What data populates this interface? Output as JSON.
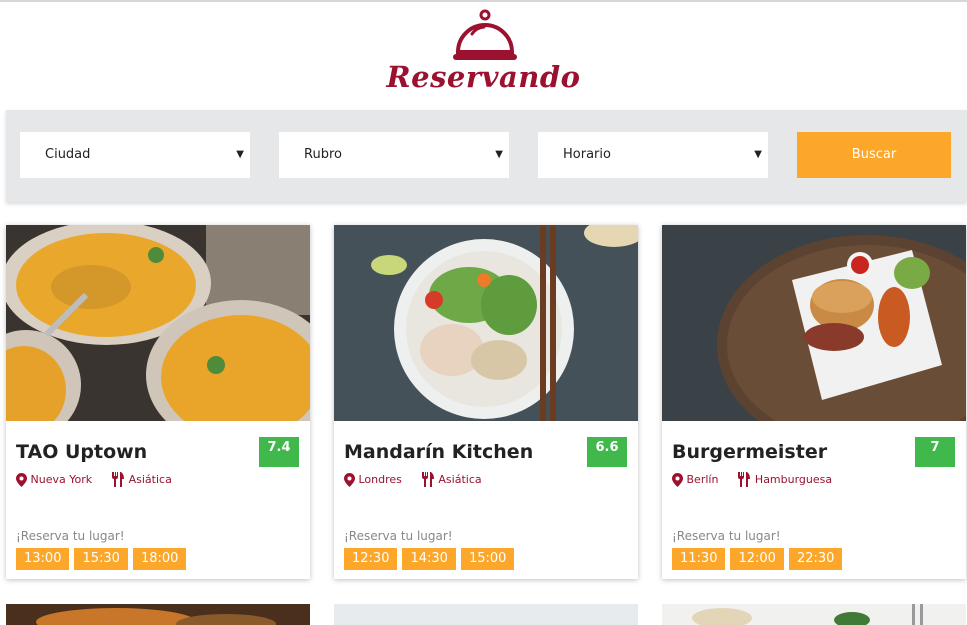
{
  "brand": {
    "name": "Reservando",
    "color": "#9b1230"
  },
  "search": {
    "city_label": "Ciudad",
    "rubro_label": "Rubro",
    "hour_label": "Horario",
    "button_label": "Buscar",
    "button_color": "#fca72a"
  },
  "restaurants": [
    {
      "name": "TAO Uptown",
      "score": "7.4",
      "city": "Nueva York",
      "category": "Asiática",
      "reserve_label": "¡Reserva tu lugar!",
      "slots": [
        "13:00",
        "15:30",
        "18:00"
      ]
    },
    {
      "name": "Mandarín Kitchen",
      "score": "6.6",
      "city": "Londres",
      "category": "Asiática",
      "reserve_label": "¡Reserva tu lugar!",
      "slots": [
        "12:30",
        "14:30",
        "15:00"
      ]
    },
    {
      "name": "Burgermeister",
      "score": "7",
      "city": "Berlín",
      "category": "Hamburguesa",
      "reserve_label": "¡Reserva tu lugar!",
      "slots": [
        "11:30",
        "12:00",
        "22:30"
      ]
    }
  ],
  "icons": {
    "logo": "cloche-icon",
    "location": "map-pin-icon",
    "category": "fork-knife-icon",
    "dropdown": "caret-down-icon"
  },
  "colors": {
    "score": "#40b84c",
    "slot": "#fca72a",
    "meta": "#9b1230"
  }
}
